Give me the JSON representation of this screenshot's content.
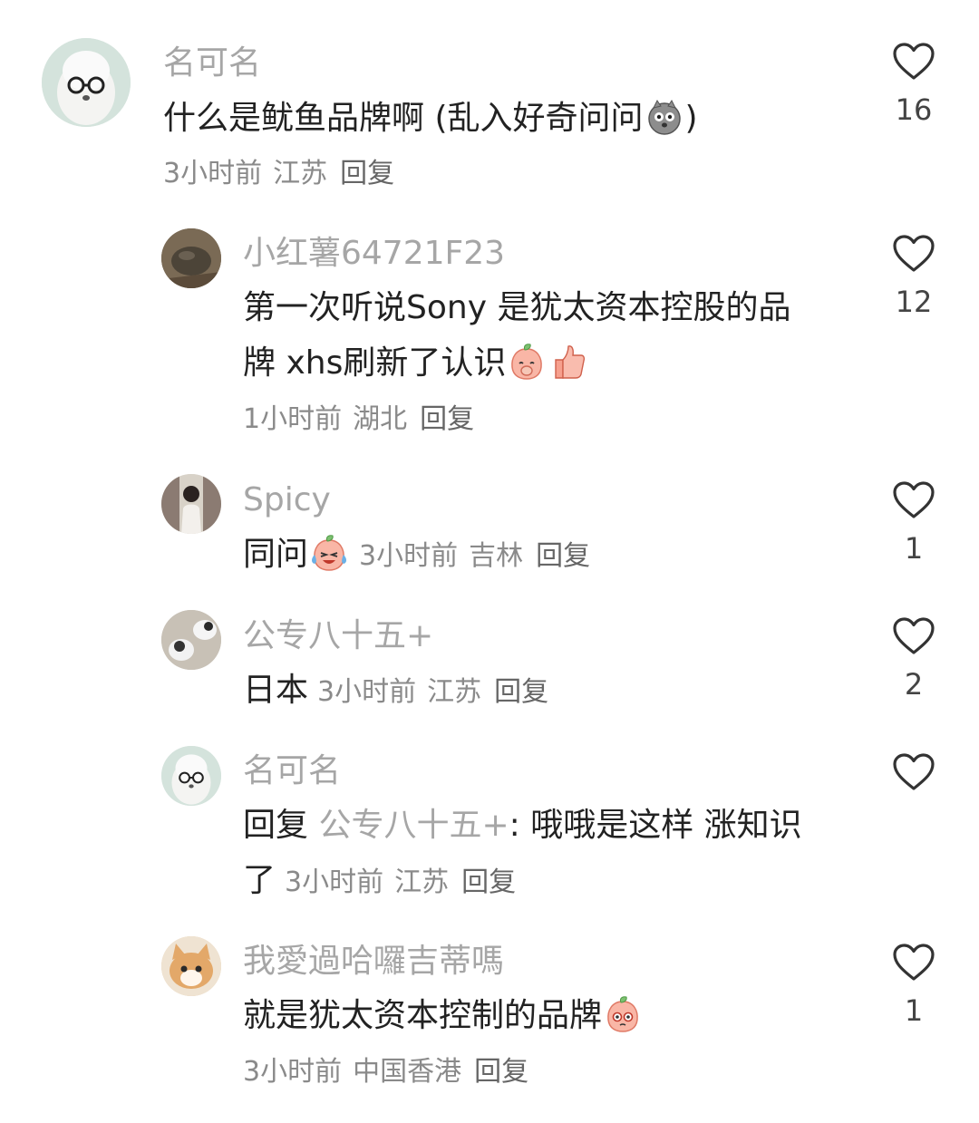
{
  "comments": [
    {
      "username": "名可名",
      "text_1": "什么是鱿鱼品牌啊 (乱入好奇问问",
      "text_1_tail": ")",
      "time": "3小时前",
      "location": "江苏",
      "reply_label": "回复",
      "likes": "16",
      "avatar_icon": "sheep-with-glasses-avatar",
      "emoji_icon": "cat-face-emoji"
    },
    {
      "username": "小红薯64721F23",
      "text_1": "第一次听说Sony 是犹太资本控股的品",
      "text_2": "牌 xhs刷新了认识",
      "time": "1小时前",
      "location": "湖北",
      "reply_label": "回复",
      "likes": "12",
      "avatar_icon": "rock-photo-avatar",
      "emoji_icon": "shy-peach-emoji",
      "emoji_icon_2": "thumbs-up-emoji"
    },
    {
      "username": "Spicy",
      "text_1": "同问",
      "time": "3小时前",
      "location": "吉林",
      "reply_label": "回复",
      "likes": "1",
      "avatar_icon": "girl-photo-avatar",
      "emoji_icon": "laugh-cry-peach-emoji"
    },
    {
      "username": "公专八十五+",
      "text_1": "日本",
      "time": "3小时前",
      "location": "江苏",
      "reply_label": "回复",
      "likes": "2",
      "avatar_icon": "cat-photo-avatar"
    },
    {
      "username": "名可名",
      "reply_prefix": "回复",
      "mention": "公专八十五+",
      "text_1": ": 哦哦是这样 涨知识",
      "text_2": "了",
      "time": "3小时前",
      "location": "江苏",
      "reply_label": "回复",
      "likes": "",
      "avatar_icon": "sheep-with-glasses-avatar"
    },
    {
      "username": "我愛過哈囉吉蒂嗎",
      "text_1": "就是犹太资本控制的品牌",
      "time": "3小时前",
      "location": "中国香港",
      "reply_label": "回复",
      "likes": "1",
      "avatar_icon": "kitten-photo-avatar",
      "emoji_icon": "staring-peach-emoji"
    }
  ],
  "icons": {
    "like": "heart-outline-icon"
  },
  "colors": {
    "username": "#a6a6a6",
    "text": "#222222",
    "meta": "#8a8a8a"
  }
}
